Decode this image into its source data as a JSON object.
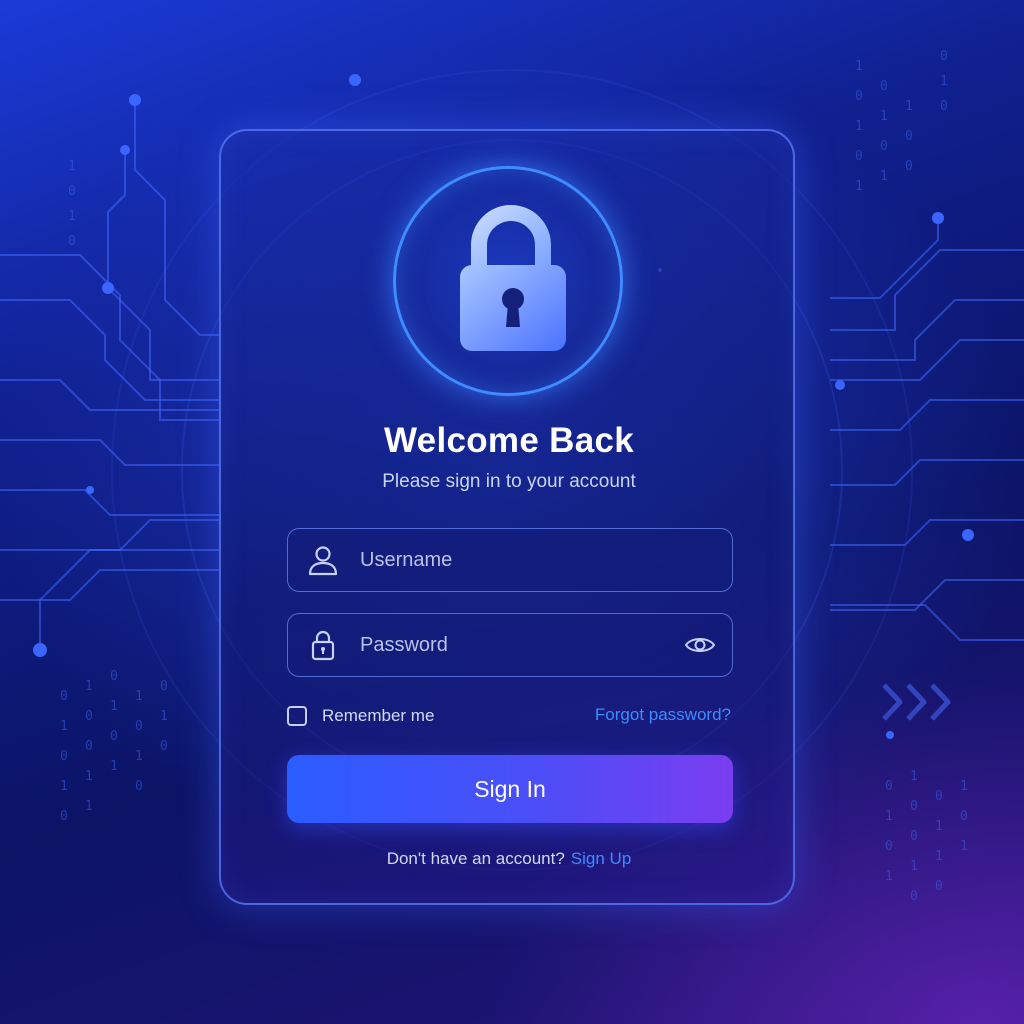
{
  "login": {
    "title": "Welcome Back",
    "subtitle": "Please sign in to your account",
    "username": {
      "placeholder": "Username",
      "value": "",
      "icon": "user-icon"
    },
    "password": {
      "placeholder": "Password",
      "value": "",
      "icon": "lock-icon",
      "toggle_icon": "eye-icon"
    },
    "remember_label": "Remember me",
    "remember_checked": false,
    "forgot_label": "Forgot password?",
    "signin_label": "Sign In",
    "no_account_text": "Don't have an account?",
    "signup_label": "Sign Up"
  },
  "decor": {
    "hero_icon": "padlock-icon",
    "background": "circuit-pattern",
    "chevrons_icon": "chevrons-right-icon"
  },
  "colors": {
    "accent": "#3d8cff",
    "button_start": "#2a5cff",
    "button_end": "#7a3df0",
    "card_border": "#5c80ff"
  }
}
